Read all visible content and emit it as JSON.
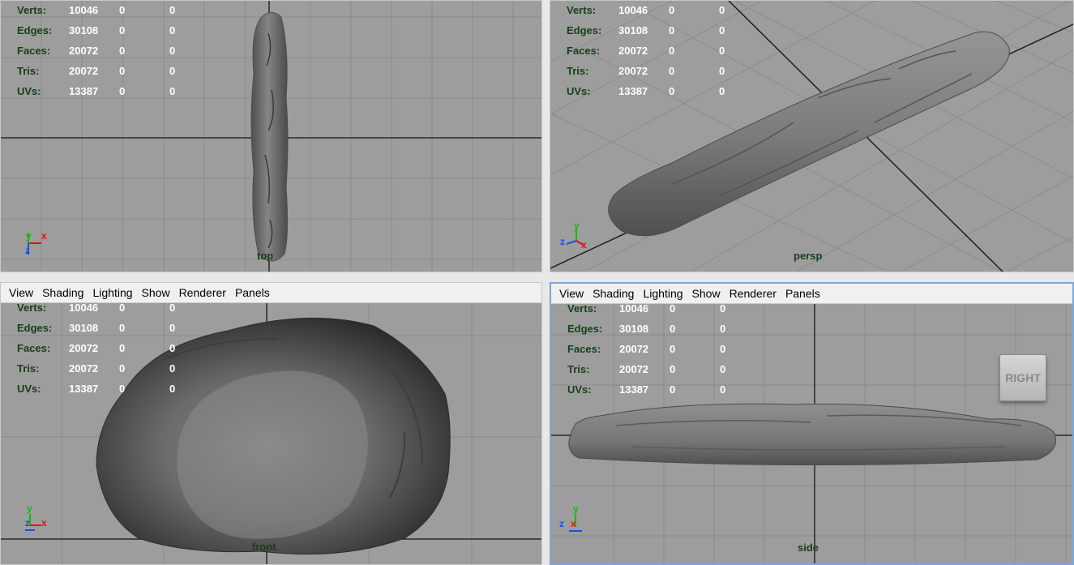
{
  "menu": [
    "View",
    "Shading",
    "Lighting",
    "Show",
    "Renderer",
    "Panels"
  ],
  "hud": {
    "labels": [
      "Verts:",
      "Edges:",
      "Faces:",
      "Tris:",
      "UVs:"
    ],
    "values": [
      "10046",
      "30108",
      "20072",
      "20072",
      "13387"
    ],
    "sel1": "0",
    "sel2": "0"
  },
  "axis_labels": {
    "x": "x",
    "y": "y",
    "z": "z"
  },
  "colors": {
    "axis_x": "#e01515",
    "axis_y": "#14b814",
    "axis_z": "#1a4fe0",
    "hud_label": "#173f17",
    "hud_value": "#ffffff",
    "viewport_bg": "#9d9d9d",
    "grid": "#8a8a8a",
    "mesh": "#6f6f6f"
  },
  "viewports": {
    "top": {
      "camera": "top"
    },
    "persp": {
      "camera": "persp"
    },
    "front": {
      "camera": "front"
    },
    "side": {
      "camera": "side",
      "viewcube_label": "RIGHT"
    }
  }
}
